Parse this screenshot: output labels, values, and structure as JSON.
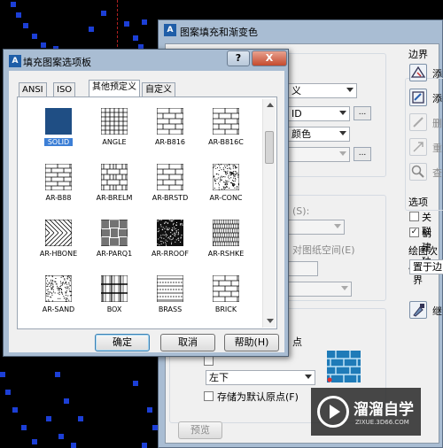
{
  "back_dialog": {
    "title": "图案填充和渐变色",
    "partial_texts": {
      "type_value": "义",
      "pattern_value": "ID",
      "color_value": "颜色",
      "angle_label_fragment": "(S):",
      "relative_paper_space": "对图纸空间(E)",
      "origin_fragment": "点",
      "store_default_origin": "存储为默认原点(F)",
      "position_combo": "左下",
      "preview_button": "预览"
    },
    "right_panel": {
      "boundary_heading": "边界",
      "add_pick_points": "添",
      "add_select_objects": "添",
      "remove_boundaries": "删",
      "recreate_boundary": "重",
      "view_selections": "查",
      "options_heading": "选项",
      "associative": "关联",
      "create_separate": "创建独",
      "draw_order_label": "绘图次序",
      "draw_order_value": "置于边界",
      "inherit": "继"
    }
  },
  "front_dialog": {
    "title": "填充图案选项板",
    "help_caption": "?",
    "close_caption": "X",
    "tabs": [
      "ANSI",
      "ISO",
      "其他预定义",
      "自定义"
    ],
    "active_tab": 2,
    "patterns": [
      {
        "name": "SOLID",
        "icon": "solid-fill"
      },
      {
        "name": "ANGLE",
        "icon": "angle-grid"
      },
      {
        "name": "AR-B816",
        "icon": "brick"
      },
      {
        "name": "AR-B816C",
        "icon": "brick"
      },
      {
        "name": "AR-B88",
        "icon": "brick-small"
      },
      {
        "name": "AR-BRELM",
        "icon": "brick-english"
      },
      {
        "name": "AR-BRSTD",
        "icon": "brick"
      },
      {
        "name": "AR-CONC",
        "icon": "concrete"
      },
      {
        "name": "AR-HBONE",
        "icon": "herringbone"
      },
      {
        "name": "AR-PARQ1",
        "icon": "parquet"
      },
      {
        "name": "AR-RROOF",
        "icon": "roof-speckle"
      },
      {
        "name": "AR-RSHKE",
        "icon": "shake"
      },
      {
        "name": "AR-SAND",
        "icon": "sand"
      },
      {
        "name": "BOX",
        "icon": "box"
      },
      {
        "name": "BRASS",
        "icon": "brass"
      },
      {
        "name": "BRICK",
        "icon": "brick"
      }
    ],
    "selected_pattern": "SOLID",
    "ok_button": "确定",
    "cancel_button": "取消",
    "help_button": "帮助(H)"
  },
  "watermark": {
    "brand": "溜溜自学",
    "url": "ZIXUE.3D66.COM"
  },
  "colors": {
    "title_bar": "#a9bdd3",
    "dialog_face": "#f0f0f0",
    "selection": "#3c7fd6",
    "cad_background": "#000000",
    "cad_dots": "#1c3fd6"
  }
}
